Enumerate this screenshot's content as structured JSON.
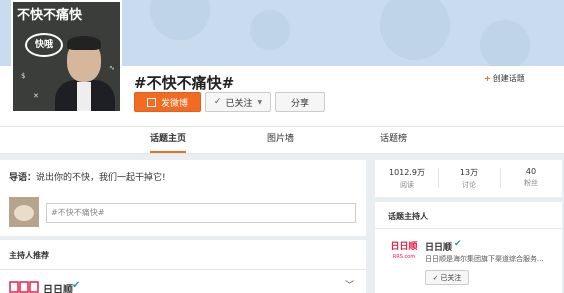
{
  "cover": {
    "title": "不快不痛快",
    "bubble_text": "快哦"
  },
  "topic": {
    "title": "#不快不痛快#",
    "create_label": "创建话题",
    "post_label": "发微博",
    "follow_label": "已关注",
    "share_label": "分享"
  },
  "tabs": [
    "话题主页",
    "图片墙",
    "话题榜"
  ],
  "guide": {
    "prefix": "导语：",
    "text": "说出你的不快，我们一起干掉它!"
  },
  "composer": {
    "placeholder": "#不快不痛快#"
  },
  "host_recommend": {
    "heading": "主持人推荐",
    "name": "日日顺"
  },
  "stats": [
    {
      "value": "1012.9万",
      "label": "阅读"
    },
    {
      "value": "13万",
      "label": "讨论"
    },
    {
      "value": "40",
      "label": "粉丝"
    }
  ],
  "host": {
    "heading": "话题主持人",
    "logo_line1": "日日顺",
    "logo_line2": "RRS.com",
    "name": "日日顺",
    "description": "日日顺是海尔集团旗下渠道综合服务...",
    "follow_label": "已关注"
  },
  "colors": {
    "accent": "#f26b23",
    "verify": "#2a8fd6",
    "brand_red": "#e5204b"
  }
}
